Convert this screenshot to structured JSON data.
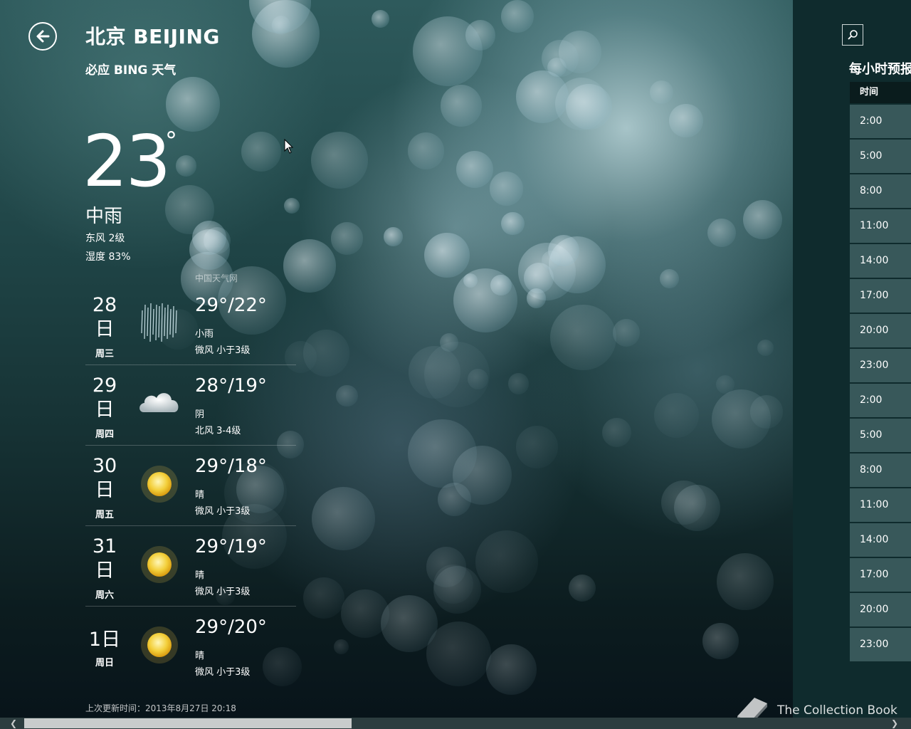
{
  "header": {
    "city": "北京 BEIJING",
    "provider": "必应 BING 天气",
    "back_icon": "arrow-left-icon",
    "search_icon": "search-icon"
  },
  "current": {
    "temp": "23",
    "degree": "°",
    "condition": "中雨",
    "wind": "东风 2级",
    "humidity": "湿度 83%"
  },
  "source": "中国天气网",
  "daily": [
    {
      "date": "28",
      "unit": "日",
      "weekday": "周三",
      "temp": "29°/22°",
      "condition": "小雨",
      "wind": "微风 小于3级",
      "icon": "rain-icon"
    },
    {
      "date": "29",
      "unit": "日",
      "weekday": "周四",
      "temp": "28°/19°",
      "condition": "阴",
      "wind": "北风 3-4级",
      "icon": "cloud-icon"
    },
    {
      "date": "30",
      "unit": "日",
      "weekday": "周五",
      "temp": "29°/18°",
      "condition": "晴",
      "wind": "微风 小于3级",
      "icon": "sun-icon"
    },
    {
      "date": "31",
      "unit": "日",
      "weekday": "周六",
      "temp": "29°/19°",
      "condition": "晴",
      "wind": "微风 小于3级",
      "icon": "sun-icon"
    },
    {
      "date": "1日",
      "unit": "",
      "weekday": "周日",
      "temp": "29°/20°",
      "condition": "晴",
      "wind": "微风 小于3级",
      "icon": "sun-icon"
    }
  ],
  "updated": "上次更新时间：2013年8月27日 20:18",
  "hourly": {
    "title": "每小时预报",
    "header": "时间",
    "times": [
      "2:00",
      "5:00",
      "8:00",
      "11:00",
      "14:00",
      "17:00",
      "20:00",
      "23:00",
      "2:00",
      "5:00",
      "8:00",
      "11:00",
      "14:00",
      "17:00",
      "20:00",
      "23:00"
    ]
  },
  "watermark": "The Collection Book",
  "colors": {
    "panel": "#0f2b2d",
    "cell": "#38585a",
    "table_head": "#0a1c1d"
  }
}
